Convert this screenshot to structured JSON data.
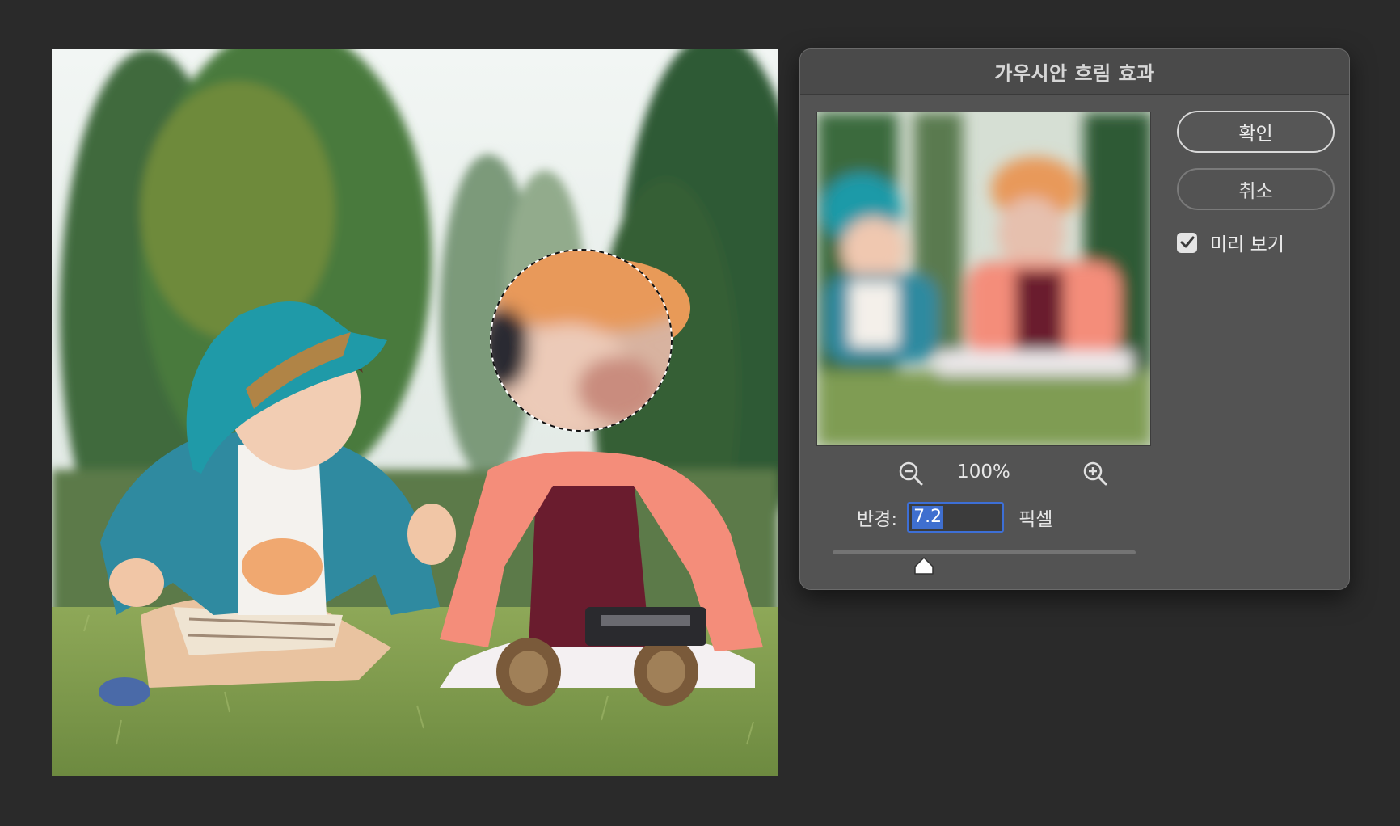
{
  "dialog": {
    "title": "가우시안 흐림 효과",
    "ok_label": "확인",
    "cancel_label": "취소",
    "preview_label": "미리 보기",
    "preview_checked": true,
    "zoom_level": "100%",
    "radius_label": "반경:",
    "radius_value": "7.2",
    "radius_unit": "픽셀",
    "slider_fraction": 0.3
  },
  "icons": {
    "zoom_out": "zoom-out-icon",
    "zoom_in": "zoom-in-icon",
    "checkmark": "checkmark-icon",
    "slider_thumb": "slider-thumb-icon"
  },
  "colors": {
    "app_background": "#2a2a2a",
    "dialog_background": "#535353",
    "selection_highlight": "#3f6fcf"
  }
}
